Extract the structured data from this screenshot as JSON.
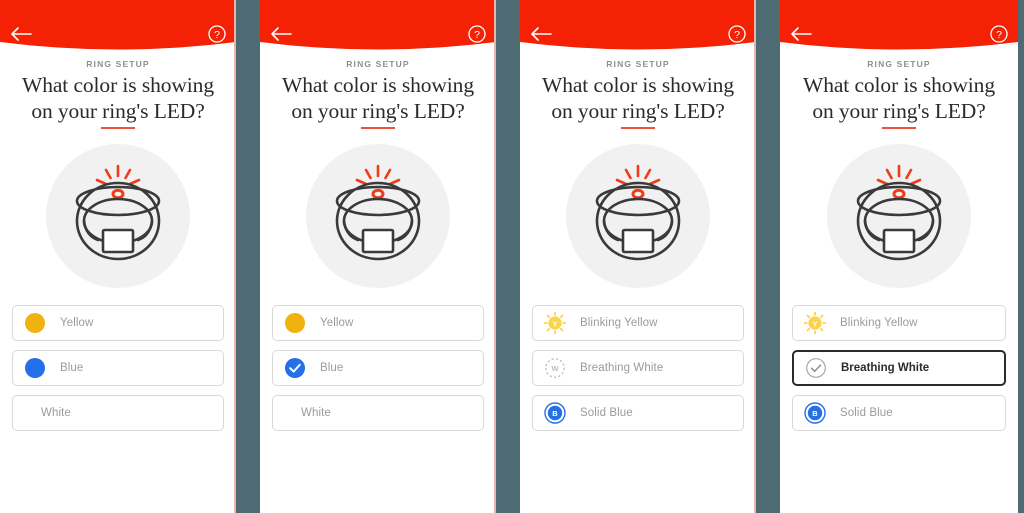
{
  "theme": {
    "header_red": "#F52105",
    "gutter": "#4E6B73",
    "accent_orange": "#E8543B",
    "yellow": "#EFB20E",
    "blue": "#2470E8",
    "icon_yellow": "#FCD34D",
    "text_gray": "#9B9B9B",
    "text_dark": "#2B2B2B"
  },
  "header": {
    "back_icon": "back-arrow-icon",
    "help_icon": "help-question-icon"
  },
  "content": {
    "eyebrow": "RING SETUP",
    "headline_line1": "What color is showing",
    "headline_line2": "on your ring's LED?",
    "illustration": "ring-device-led-illustration"
  },
  "panels": [
    {
      "id": "panel-1",
      "options": [
        {
          "label": "Yellow",
          "icon": "yellow-dot-icon",
          "icon_type": "dot-yellow",
          "selected": false
        },
        {
          "label": "Blue",
          "icon": "blue-dot-icon",
          "icon_type": "dot-blue",
          "selected": false
        },
        {
          "label": "White",
          "icon": "none",
          "icon_type": "none",
          "selected": false
        }
      ]
    },
    {
      "id": "panel-2",
      "options": [
        {
          "label": "Yellow",
          "icon": "yellow-dot-icon",
          "icon_type": "dot-yellow",
          "selected": false
        },
        {
          "label": "Blue",
          "icon": "blue-check-circle-icon",
          "icon_type": "check-blue",
          "selected": false
        },
        {
          "label": "White",
          "icon": "none",
          "icon_type": "none",
          "selected": false
        }
      ]
    },
    {
      "id": "panel-3",
      "options": [
        {
          "label": "Blinking Yellow",
          "icon": "blinking-yellow-sun-icon",
          "icon_type": "sun-y",
          "selected": false
        },
        {
          "label": "Breathing White",
          "icon": "breathing-white-dashed-icon",
          "icon_type": "dashed-w",
          "selected": false
        },
        {
          "label": "Solid Blue",
          "icon": "solid-blue-ring-icon",
          "icon_type": "ring-b",
          "selected": false
        }
      ]
    },
    {
      "id": "panel-4",
      "options": [
        {
          "label": "Blinking Yellow",
          "icon": "blinking-yellow-sun-icon",
          "icon_type": "sun-y",
          "selected": false
        },
        {
          "label": "Breathing White",
          "icon": "gray-check-circle-icon",
          "icon_type": "check-gray",
          "selected": true
        },
        {
          "label": "Solid Blue",
          "icon": "solid-blue-ring-icon",
          "icon_type": "ring-b",
          "selected": false
        }
      ]
    }
  ]
}
